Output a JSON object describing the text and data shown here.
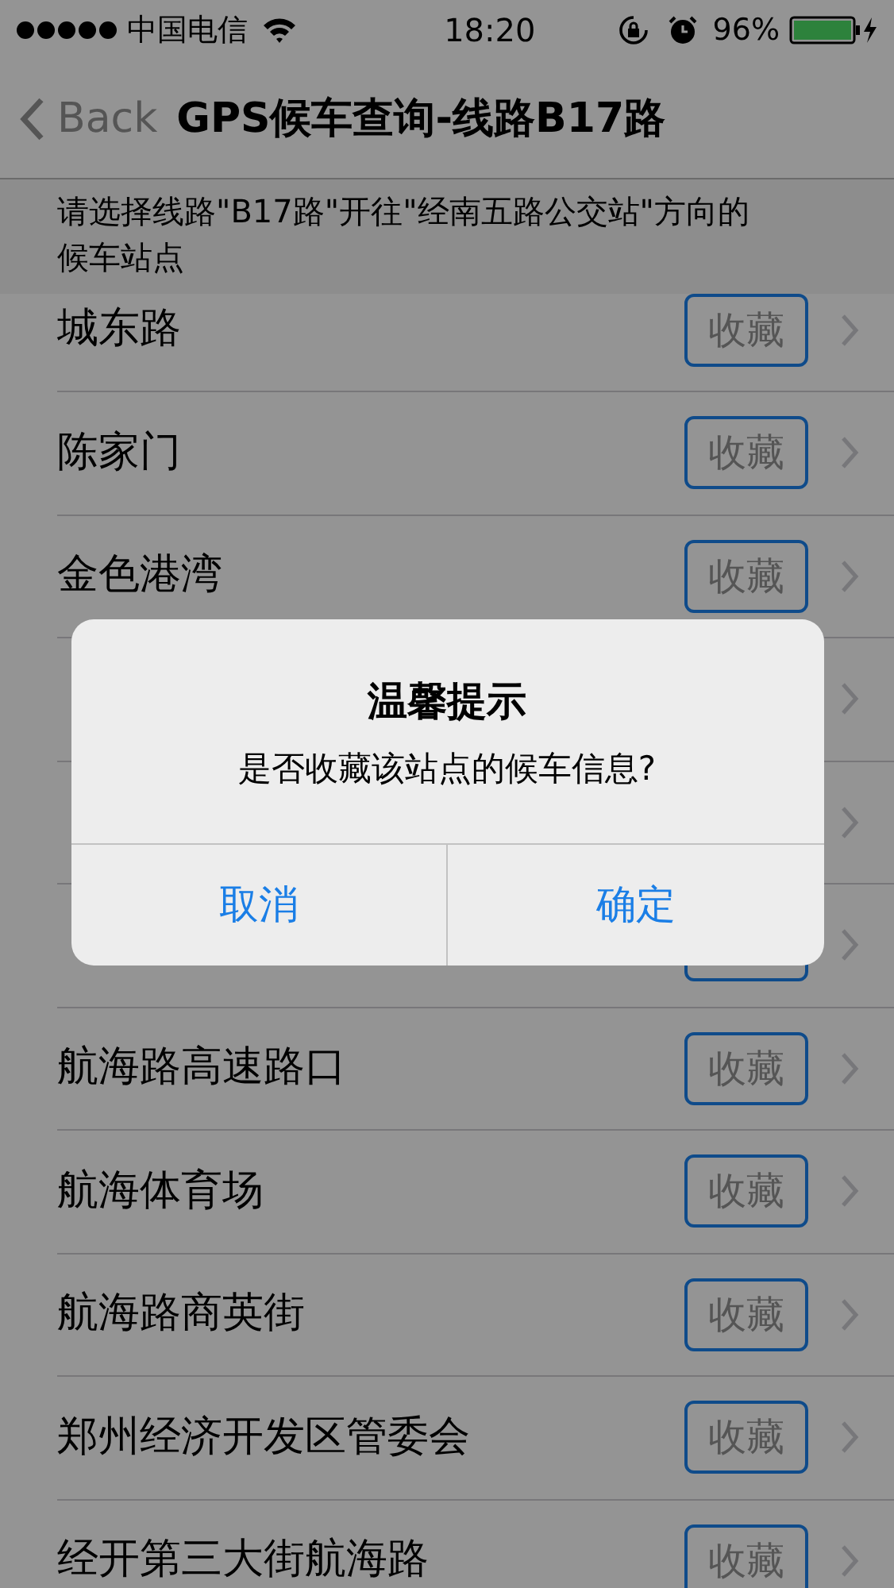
{
  "status_bar": {
    "carrier": "中国电信",
    "time": "18:20",
    "battery": "96%"
  },
  "nav": {
    "back": "Back",
    "title": "GPS候车查询-线路B17路"
  },
  "hint": "请选择线路\"B17路\"开往\"经南五路公交站\"方向的候车站点",
  "stops": [
    {
      "name": "城东路",
      "button": "收藏",
      "chevron": true
    },
    {
      "name": "陈家门",
      "button": "收藏",
      "chevron": true
    },
    {
      "name": "金色港湾",
      "button": "收藏",
      "chevron": true
    },
    {
      "chevron": true
    },
    {
      "chevron": true
    },
    {
      "kind": "covered",
      "chevron": true
    },
    {
      "name": "航海路高速路口",
      "button": "收藏",
      "chevron": true
    },
    {
      "name": "航海体育场",
      "button": "收藏",
      "chevron": true
    },
    {
      "name": "航海路商英街",
      "button": "收藏",
      "chevron": true
    },
    {
      "name": "郑州经济开发区管委会",
      "button": "收藏",
      "chevron": true
    },
    {
      "name": "经开第三大街航海路",
      "button": "收藏",
      "chevron": true
    }
  ],
  "dialog": {
    "title": "温馨提示",
    "message": "是否收藏该站点的候车信息?",
    "buttons": [
      "取消",
      "确定"
    ]
  }
}
